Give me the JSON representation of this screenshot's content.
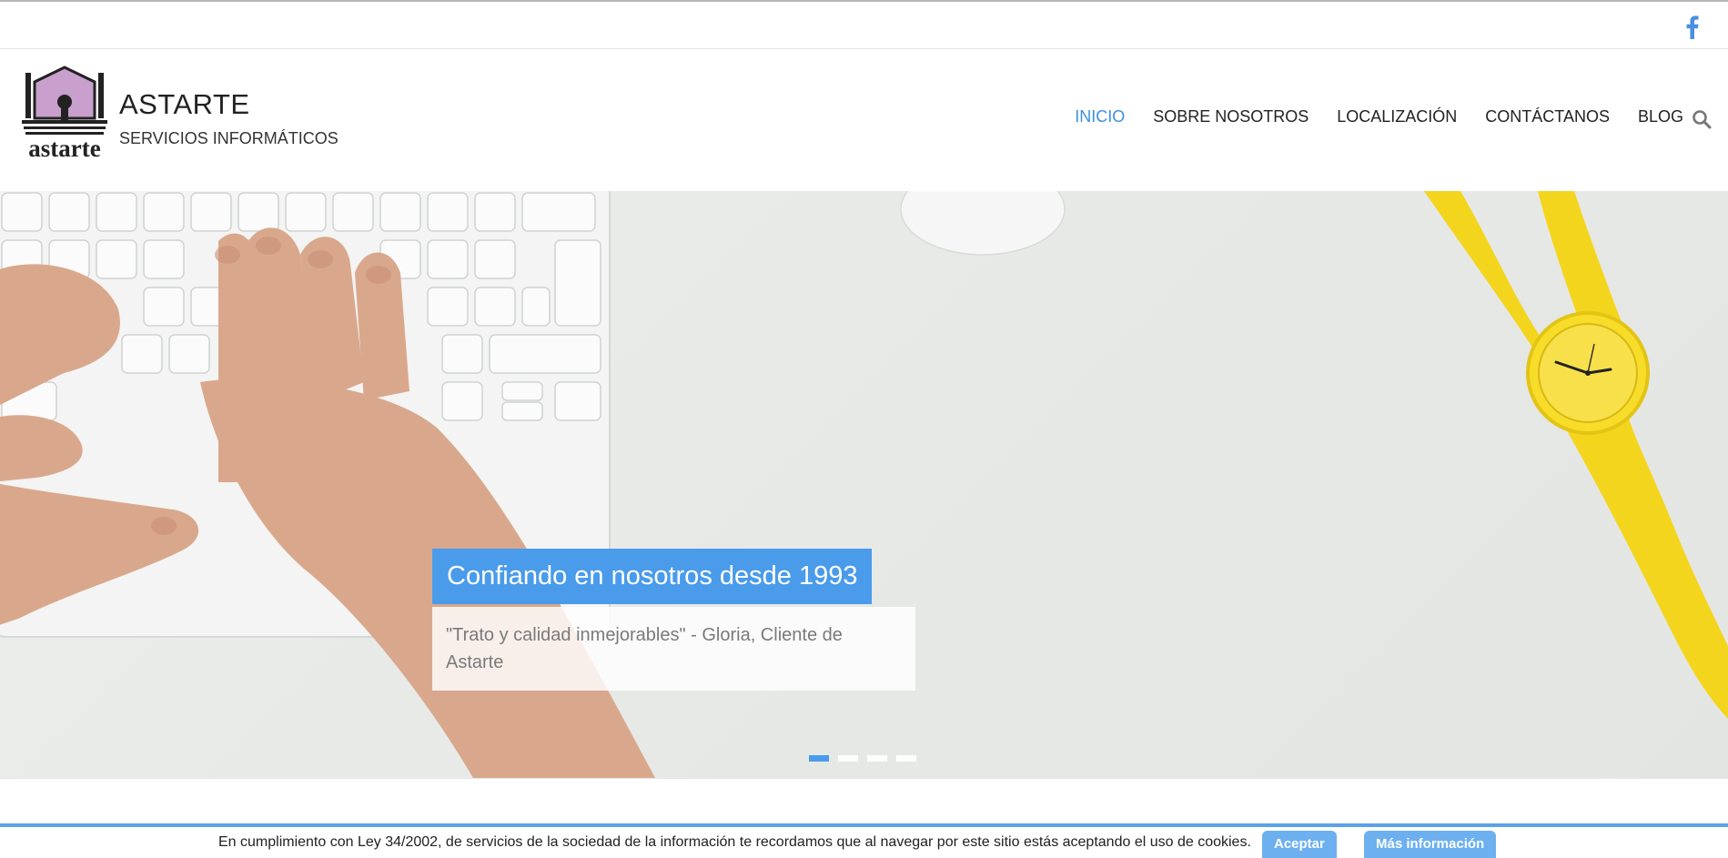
{
  "topbar": {
    "social_icon": "facebook-icon"
  },
  "header": {
    "logo_text": "astarte",
    "title": "ASTARTE",
    "subtitle": "SERVICIOS INFORMÁTICOS"
  },
  "nav": {
    "items": [
      {
        "label": "INICIO",
        "active": true
      },
      {
        "label": "SOBRE NOSOTROS",
        "active": false
      },
      {
        "label": "LOCALIZACIÓN",
        "active": false
      },
      {
        "label": "CONTÁCTANOS",
        "active": false
      },
      {
        "label": "BLOG",
        "active": false
      }
    ],
    "search_icon": "search-icon"
  },
  "hero": {
    "caption_title": "Confiando en nosotros desde 1993",
    "caption_quote": "\"Trato y calidad inmejorables\" - Gloria, Cliente de Astarte",
    "slides": 4,
    "active_slide": 1
  },
  "cookie": {
    "text": "En cumplimiento con Ley 34/2002, de servicios de la sociedad de la información te recordamos que al navegar por este sitio estás aceptando el uso de cookies.",
    "accept_label": "Aceptar",
    "more_label": "Más información"
  },
  "colors": {
    "accent": "#4a9bea",
    "logo_purple": "#c89fcd",
    "watch_yellow": "#f4d51d"
  }
}
